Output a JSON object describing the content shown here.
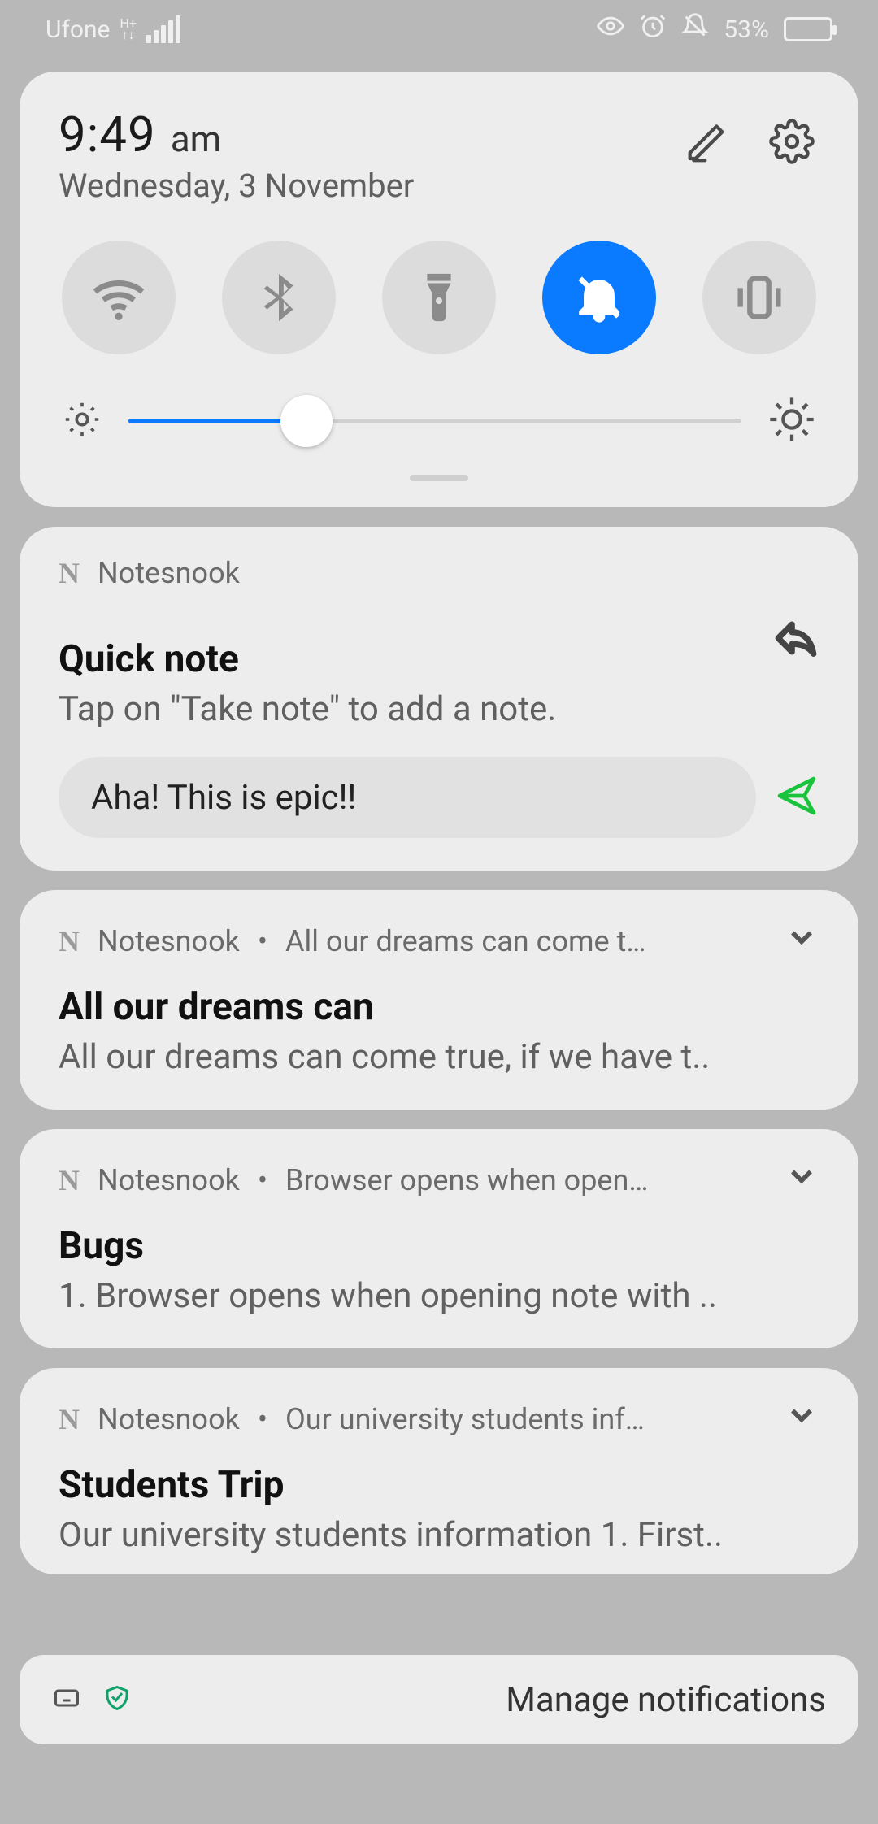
{
  "status": {
    "carrier": "Ufone",
    "battery_pct": "53%"
  },
  "qs": {
    "time": "9:49",
    "ampm": "am",
    "date": "Wednesday, 3 November",
    "brightness_pct": 29
  },
  "notifications": [
    {
      "app": "Notesnook",
      "title": "Quick note",
      "body": "Tap on \"Take note\" to add a note.",
      "input_value": "Aha! This is epic!!"
    },
    {
      "app": "Notesnook",
      "summary": "All our dreams can come t…",
      "title": "All our dreams can",
      "body": "All our dreams can come true, if we have t.."
    },
    {
      "app": "Notesnook",
      "summary": "Browser opens when open…",
      "title": "Bugs",
      "body": "1. Browser opens when opening note with .."
    },
    {
      "app": "Notesnook",
      "summary": "Our university students inf…",
      "title": "Students Trip",
      "body": "Our university students information 1. First.."
    }
  ],
  "bottom": {
    "manage": "Manage notifications"
  }
}
